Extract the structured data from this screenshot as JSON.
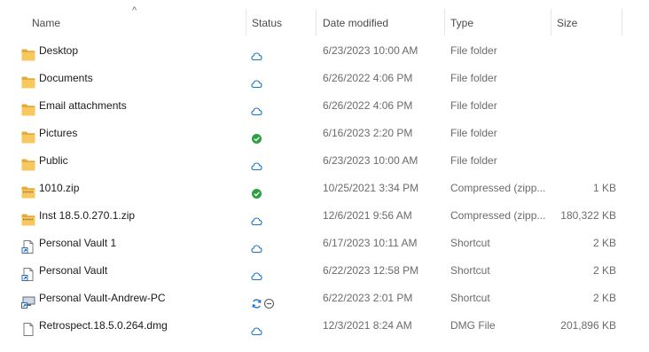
{
  "columns": {
    "name": "Name",
    "status": "Status",
    "date": "Date modified",
    "type": "Type",
    "size": "Size"
  },
  "sort_indicator": "^",
  "files": [
    {
      "name": "Desktop",
      "icon": "folder-icon",
      "status": [
        "cloud-icon"
      ],
      "date": "6/23/2023 10:00 AM",
      "type": "File folder",
      "size": ""
    },
    {
      "name": "Documents",
      "icon": "folder-icon",
      "status": [
        "cloud-icon"
      ],
      "date": "6/26/2022 4:06 PM",
      "type": "File folder",
      "size": ""
    },
    {
      "name": "Email attachments",
      "icon": "folder-icon",
      "status": [
        "cloud-icon"
      ],
      "date": "6/26/2022 4:06 PM",
      "type": "File folder",
      "size": ""
    },
    {
      "name": "Pictures",
      "icon": "folder-icon",
      "status": [
        "synced-check-icon"
      ],
      "date": "6/16/2023 2:20 PM",
      "type": "File folder",
      "size": ""
    },
    {
      "name": "Public",
      "icon": "folder-icon",
      "status": [
        "cloud-icon"
      ],
      "date": "6/23/2023 10:00 AM",
      "type": "File folder",
      "size": ""
    },
    {
      "name": "1010.zip",
      "icon": "zip-folder-icon",
      "status": [
        "synced-check-icon"
      ],
      "date": "10/25/2021 3:34 PM",
      "type": "Compressed (zipp...",
      "size": "1 KB"
    },
    {
      "name": "Inst 18.5.0.270.1.zip",
      "icon": "zip-folder-icon",
      "status": [
        "cloud-icon"
      ],
      "date": "12/6/2021 9:56 AM",
      "type": "Compressed (zipp...",
      "size": "180,322 KB"
    },
    {
      "name": "Personal Vault 1",
      "icon": "shortcut-icon",
      "status": [
        "cloud-icon"
      ],
      "date": "6/17/2023 10:11 AM",
      "type": "Shortcut",
      "size": "2 KB"
    },
    {
      "name": "Personal Vault",
      "icon": "shortcut-icon",
      "status": [
        "cloud-icon"
      ],
      "date": "6/22/2023 12:58 PM",
      "type": "Shortcut",
      "size": "2 KB"
    },
    {
      "name": "Personal Vault-Andrew-PC",
      "icon": "pc-shortcut-icon",
      "status": [
        "sync-icon",
        "excluded-icon"
      ],
      "date": "6/22/2023 2:01 PM",
      "type": "Shortcut",
      "size": "2 KB"
    },
    {
      "name": "Retrospect.18.5.0.264.dmg",
      "icon": "file-icon",
      "status": [
        "cloud-icon"
      ],
      "date": "12/3/2021 8:24 AM",
      "type": "DMG File",
      "size": "201,896 KB"
    }
  ],
  "colors": {
    "folder": "#f2c14e",
    "cloud": "#1a73c9",
    "synced": "#2ea043",
    "text_muted": "#6b6b6b"
  }
}
